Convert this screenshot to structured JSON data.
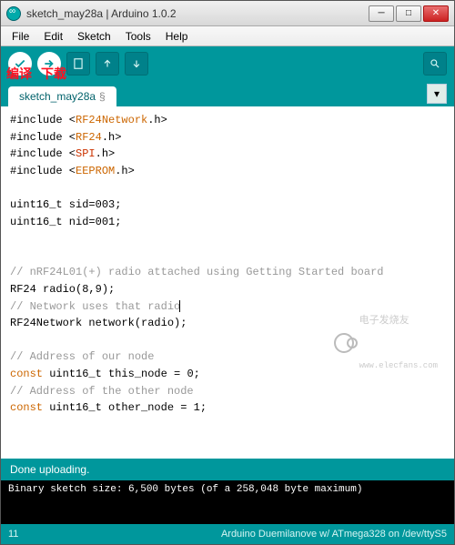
{
  "window": {
    "title": "sketch_may28a | Arduino 1.0.2"
  },
  "menu": {
    "file": "File",
    "edit": "Edit",
    "sketch": "Sketch",
    "tools": "Tools",
    "help": "Help"
  },
  "annotations": {
    "compile": "编译",
    "download": "下载"
  },
  "tab": {
    "name": "sketch_may28a",
    "marker": "§"
  },
  "code": {
    "l1a": "#include <",
    "l1b": "RF24Network",
    "l1c": ".h>",
    "l2a": "#include <",
    "l2b": "RF24",
    "l2c": ".h>",
    "l3a": "#include <",
    "l3b": "SPI",
    "l3c": ".h>",
    "l4a": "#include <",
    "l4b": "EEPROM",
    "l4c": ".h>",
    "l6": "uint16_t sid=003;",
    "l7": "uint16_t nid=001;",
    "l10": "// nRF24L01(+) radio attached using Getting Started board",
    "l11": "RF24 radio(8,9);",
    "l12": "// Network uses that radio",
    "l13": "RF24Network network(radio);",
    "l15": "// Address of our node",
    "l16a": "const",
    "l16b": " uint16_t this_node = 0;",
    "l17": "// Address of the other node",
    "l18a": "const",
    "l18b": " uint16_t other_node = 1;"
  },
  "status": {
    "message": "Done uploading."
  },
  "console": {
    "line1": "Binary sketch size: 6,500 bytes (of a 258,048 byte maximum)"
  },
  "footer": {
    "line": "11",
    "board": "Arduino Duemilanove w/ ATmega328 on /dev/ttyS5"
  },
  "watermark": {
    "text": "电子发烧友",
    "url": "www.elecfans.com"
  }
}
